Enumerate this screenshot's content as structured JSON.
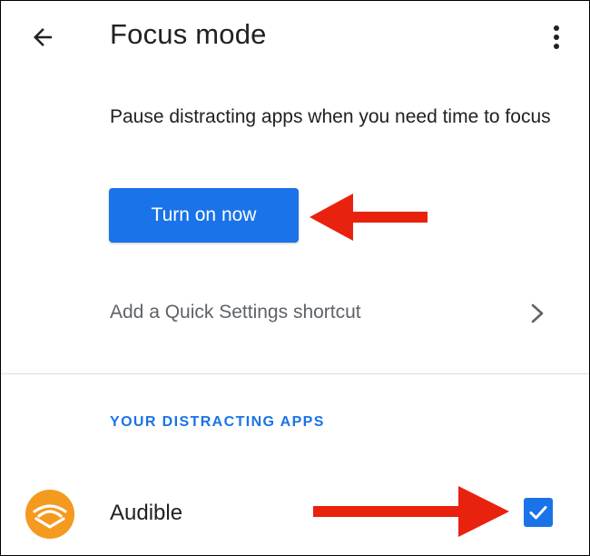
{
  "app_bar": {
    "title": "Focus mode",
    "back_icon": "arrow-back-icon",
    "menu_icon": "more-vert-icon"
  },
  "description": "Pause distracting apps when you need time to focus",
  "primary_button": {
    "label": "Turn on now"
  },
  "quick_settings": {
    "label": "Add a Quick Settings shortcut",
    "chevron_icon": "chevron-right-icon"
  },
  "section": {
    "header": "YOUR DISTRACTING APPS"
  },
  "apps": [
    {
      "name": "Audible",
      "icon": "audible-icon",
      "checked": true
    }
  ],
  "colors": {
    "accent": "#1a73e8",
    "annotation_arrow": "#e8220e",
    "audible_orange": "#f39a1f"
  }
}
